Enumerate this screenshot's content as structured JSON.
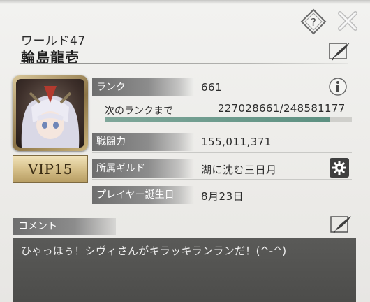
{
  "profile": {
    "world": "ワールド47",
    "name": "輪島龍壱",
    "vip": "VIP15"
  },
  "stats": {
    "rank_label": "ランク",
    "rank_value": "661",
    "next_rank_label": "次のランクまで",
    "next_rank_value": "227028661/248581177",
    "exp_fraction": 0.913,
    "power_label": "戦闘力",
    "power_value": "155,011,371",
    "guild_label": "所属ギルド",
    "guild_value": "湖に沈む三日月",
    "birthday_label": "プレイヤー誕生日",
    "birthday_value": "8月23日"
  },
  "comment": {
    "header": "コメント",
    "text": "ひゃっほぅ！シヴィさんがキラッキランランだ！(^-^)"
  },
  "icons": {
    "help": "help-icon",
    "close": "close-icon",
    "edit": "quill-pen-icon",
    "info": "info-icon",
    "gear": "gear-icon"
  },
  "colors": {
    "exp_fill": "#5d9081",
    "label_bg": "#7a7a7a",
    "comment_bg": "#4f4f4d",
    "vip_gold": "#d6c08a"
  }
}
